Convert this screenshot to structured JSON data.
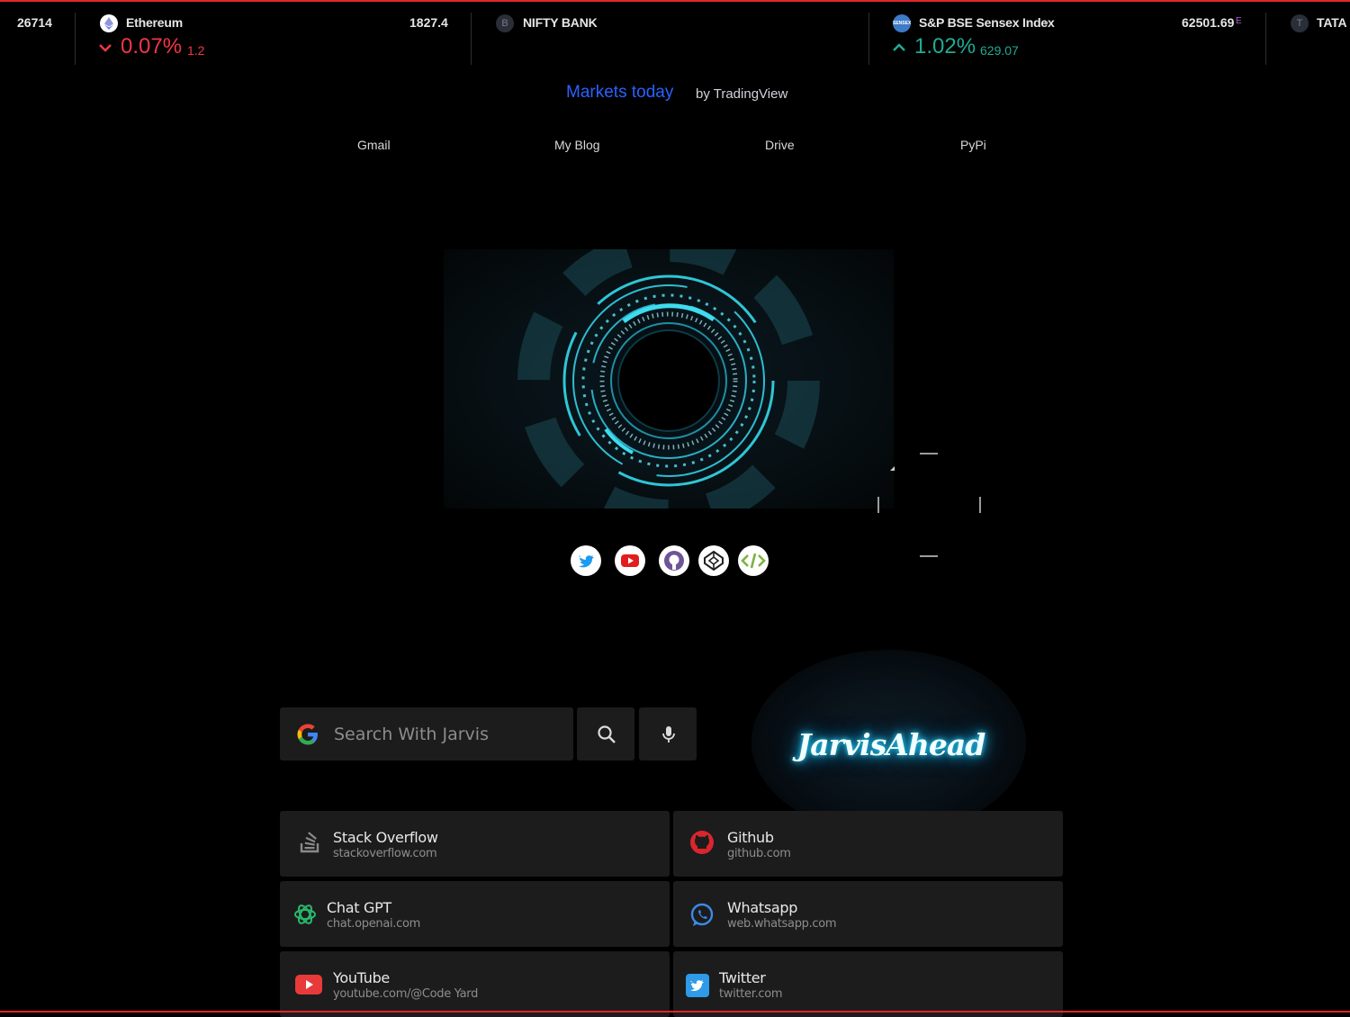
{
  "ticker": {
    "items": [
      {
        "value": "26714"
      },
      {
        "name": "Ethereum",
        "price": "1827.4",
        "pct": "0.07%",
        "abs": "1.2",
        "direction": "down"
      },
      {
        "name": "NIFTY BANK",
        "logo_letter": "B"
      },
      {
        "name": "S&P BSE Sensex Index",
        "dot": "•",
        "price": "62501.69",
        "price_suffix": "E",
        "logo_text": "SENSEX",
        "pct": "1.02%",
        "abs": "629.07",
        "direction": "up"
      },
      {
        "name": "TATA M",
        "logo_letter": "T"
      }
    ]
  },
  "widget": {
    "title": "Markets today",
    "by": "by TradingView"
  },
  "nav": {
    "links": [
      "Gmail",
      "My Blog",
      "Drive",
      "PyPi"
    ]
  },
  "social": [
    "twitter-icon",
    "youtube-icon",
    "github-icon",
    "codepen-icon",
    "code-icon"
  ],
  "search": {
    "placeholder": "Search With Jarvis"
  },
  "brand": "JarvisAhead",
  "shortcuts": [
    {
      "title": "Stack Overflow",
      "url": "stackoverflow.com",
      "icon": "stackoverflow-icon"
    },
    {
      "title": "Github",
      "url": "github.com",
      "icon": "github-icon"
    },
    {
      "title": "Chat GPT",
      "url": "chat.openai.com",
      "icon": "chatgpt-icon"
    },
    {
      "title": "Whatsapp",
      "url": "web.whatsapp.com",
      "icon": "whatsapp-icon"
    },
    {
      "title": "YouTube",
      "url": "youtube.com/@Code Yard",
      "icon": "youtube-icon"
    },
    {
      "title": "Twitter",
      "url": "twitter.com",
      "icon": "twitter-icon"
    }
  ],
  "colors": {
    "accent_red": "#e0242e",
    "down": "#f23645",
    "up": "#22ab94",
    "tv_blue": "#2962ff",
    "glow": "#27d3ff",
    "card_bg": "#1c1c1c"
  }
}
